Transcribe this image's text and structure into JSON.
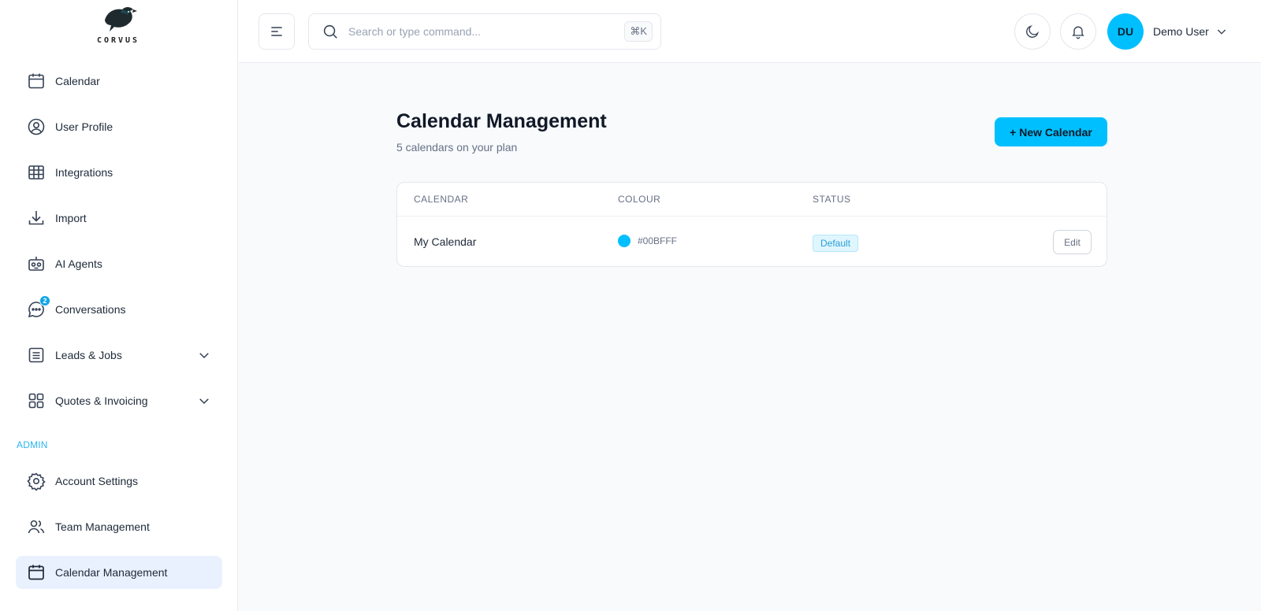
{
  "brand": {
    "name": "CORVUS"
  },
  "sidebar": {
    "items": [
      {
        "label": "Calendar",
        "icon": "calendar-icon"
      },
      {
        "label": "User Profile",
        "icon": "user-circle-icon"
      },
      {
        "label": "Integrations",
        "icon": "table-grid-icon"
      },
      {
        "label": "Import",
        "icon": "download-icon"
      },
      {
        "label": "AI Agents",
        "icon": "robot-icon"
      },
      {
        "label": "Conversations",
        "icon": "chat-bubble-icon",
        "badge": "2"
      },
      {
        "label": "Leads & Jobs",
        "icon": "list-doc-icon",
        "expandable": true
      },
      {
        "label": "Quotes & Invoicing",
        "icon": "grid-four-icon",
        "expandable": true
      }
    ],
    "admin_label": "ADMIN",
    "admin_items": [
      {
        "label": "Account Settings",
        "icon": "gear-icon"
      },
      {
        "label": "Team Management",
        "icon": "users-icon"
      },
      {
        "label": "Calendar Management",
        "icon": "calendar-icon",
        "active": true
      }
    ]
  },
  "topbar": {
    "search_placeholder": "Search or type command...",
    "search_shortcut": "⌘K",
    "user_initials": "DU",
    "user_name": "Demo User"
  },
  "main": {
    "title": "Calendar Management",
    "subtitle": "5 calendars on your plan",
    "new_button": "+ New Calendar",
    "table": {
      "headers": [
        "CALENDAR",
        "COLOUR",
        "STATUS"
      ],
      "rows": [
        {
          "name": "My Calendar",
          "colour_hex": "#00BFFF",
          "status": "Default",
          "action": "Edit"
        }
      ]
    }
  },
  "colors": {
    "accent": "#00BFFF",
    "active_nav_bg": "#EAF1FE",
    "admin_label": "#2CB3EF"
  }
}
